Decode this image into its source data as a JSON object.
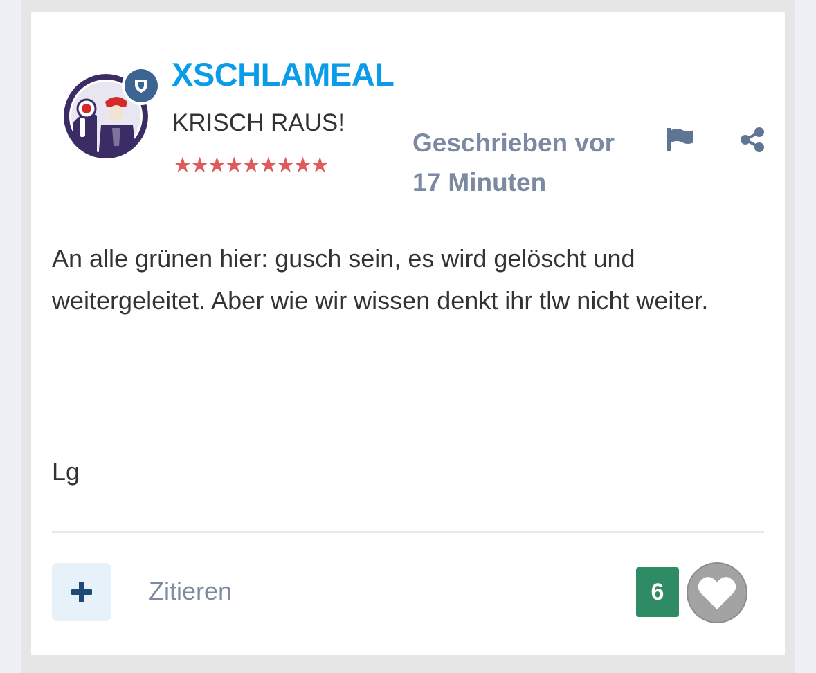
{
  "post": {
    "author": {
      "username": "XSCHLAMEAL",
      "user_title": "KRISCH RAUS!",
      "rank_stars": "★★★★★★★★★",
      "avatar_icon": "santa-claus-avatar",
      "badge_icon": "moderator-shield-icon"
    },
    "timestamp": {
      "line1": "Geschrieben vor",
      "line2": "17 Minuten"
    },
    "body": {
      "paragraph": "An alle grünen hier: gusch sein, es wird gelöscht und weitergeleitet. Aber wie wir wissen denkt ihr tlw nicht weiter.",
      "signoff": "Lg"
    },
    "actions": {
      "report_icon": "flag-icon",
      "share_icon": "share-icon",
      "multiquote_icon": "plus-icon",
      "quote_label": "Zitieren",
      "reaction_count": "6",
      "reaction_icon": "heart-icon"
    },
    "colors": {
      "username": "#0a9ce8",
      "meta_text": "#7b8aa0",
      "rank_stars": "#e05a5a",
      "moderator_badge": "#3d6594",
      "reaction_count_bg": "#2e8b63",
      "multiquote_bg": "#e7f1fa",
      "like_button_bg": "#a3a3a3"
    }
  }
}
